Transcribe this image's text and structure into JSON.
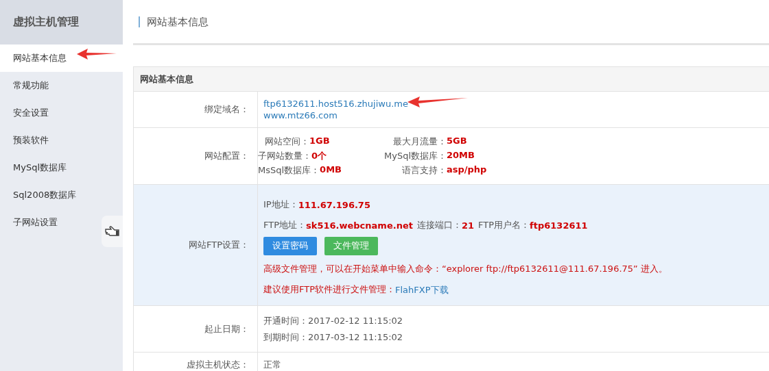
{
  "sidebar": {
    "title": "虚拟主机管理",
    "items": [
      {
        "label": "网站基本信息",
        "selected": true
      },
      {
        "label": "常规功能",
        "selected": false
      },
      {
        "label": "安全设置",
        "selected": false
      },
      {
        "label": "预装软件",
        "selected": false
      },
      {
        "label": "MySql数据库",
        "selected": false
      },
      {
        "label": "Sql2008数据库",
        "selected": false
      },
      {
        "label": "子网站设置",
        "selected": false
      }
    ]
  },
  "page_title": "网站基本信息",
  "table": {
    "heading": "网站基本信息",
    "domains": {
      "label": "绑定域名：",
      "links": [
        "ftp6132611.host516.zhujiwu.me",
        "www.mtz66.com"
      ]
    },
    "config": {
      "label": "网站配置：",
      "items": [
        {
          "label": "网站空间：",
          "value": "1GB"
        },
        {
          "label": "最大月流量：",
          "value": "5GB"
        },
        {
          "label": "子网站数量：",
          "value": "0个"
        },
        {
          "label": "MySql数据库：",
          "value": "20MB"
        },
        {
          "label": "MsSql数据库：",
          "value": "0MB"
        },
        {
          "label": "语言支持：",
          "value": "asp/php"
        }
      ]
    },
    "ftp": {
      "label": "网站FTP设置：",
      "ip": {
        "label": "IP地址：",
        "value": "111.67.196.75"
      },
      "line": [
        {
          "label": "FTP地址：",
          "value": "sk516.webcname.net"
        },
        {
          "label": "连接端口：",
          "value": "21"
        },
        {
          "label": "FTP用户名：",
          "value": "ftp6132611"
        }
      ],
      "buttons": [
        {
          "label": "设置密码",
          "kind": "primary"
        },
        {
          "label": "文件管理",
          "kind": "success"
        }
      ],
      "tip": "高级文件管理，可以在开始菜单中输入命令：“explorer ftp://ftp6132611@111.67.196.75” 进入。",
      "advice": "建议使用FTP软件进行文件管理：",
      "advice_link": "FlahFXP下载"
    },
    "dates": {
      "label": "起止日期：",
      "lines": [
        "开通时间：2017-02-12 11:15:02",
        "到期时间：2017-03-12 11:15:02"
      ]
    },
    "status": {
      "label": "虚拟主机状态：",
      "value": "正常"
    }
  }
}
